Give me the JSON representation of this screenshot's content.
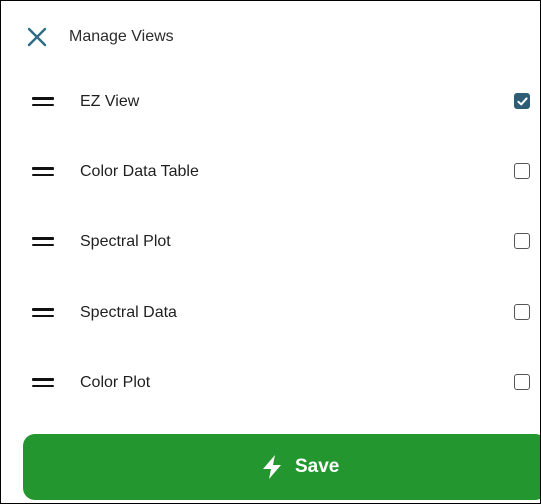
{
  "header": {
    "title": "Manage Views",
    "close_icon": "close-icon"
  },
  "views": [
    {
      "label": "EZ View",
      "checked": true
    },
    {
      "label": "Color Data Table",
      "checked": false
    },
    {
      "label": "Spectral Plot",
      "checked": false
    },
    {
      "label": "Spectral Data",
      "checked": false
    },
    {
      "label": "Color Plot",
      "checked": false
    }
  ],
  "save_button": {
    "label": "Save",
    "icon": "lightning-bolt-icon"
  },
  "colors": {
    "accent": "#2e6b87",
    "checkbox_checked": "#2e5d76",
    "save_background": "#23962f"
  }
}
